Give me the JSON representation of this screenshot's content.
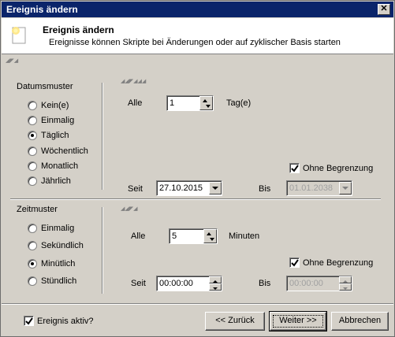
{
  "window": {
    "title": "Ereignis ändern",
    "close_glyph": "✕"
  },
  "header": {
    "title": "Ereignis ändern",
    "subtitle": "Ereignisse können Skripte bei Änderungen oder auf zyklischer Basis starten",
    "icon": "note-icon"
  },
  "datumsmuster": {
    "heading": "Datumsmuster",
    "options": [
      "Kein(e)",
      "Einmalig",
      "Täglich",
      "Wöchentlich",
      "Monatlich",
      "Jährlich"
    ],
    "selected_index": 2,
    "alle_label": "Alle",
    "alle_value": "1",
    "alle_unit": "Tag(e)",
    "ohne_begrenzung_label": "Ohne Begrenzung",
    "ohne_begrenzung_checked": true,
    "seit_label": "Seit",
    "seit_value": "27.10.2015",
    "bis_label": "Bis",
    "bis_value": "01.01.2038"
  },
  "zeitmuster": {
    "heading": "Zeitmuster",
    "options": [
      "Einmalig",
      "Sekündlich",
      "Minütlich",
      "Stündlich"
    ],
    "selected_index": 2,
    "alle_label": "Alle",
    "alle_value": "5",
    "alle_unit": "Minuten",
    "ohne_begrenzung_label": "Ohne Begrenzung",
    "ohne_begrenzung_checked": true,
    "seit_label": "Seit",
    "seit_value": "00:00:00",
    "bis_label": "Bis",
    "bis_value": "00:00:00"
  },
  "footer": {
    "ereignis_aktiv_label": "Ereignis aktiv?",
    "ereignis_aktiv_checked": true,
    "back_label": "<< Zurück",
    "next_label": "Weiter >>",
    "cancel_label": "Abbrechen"
  }
}
